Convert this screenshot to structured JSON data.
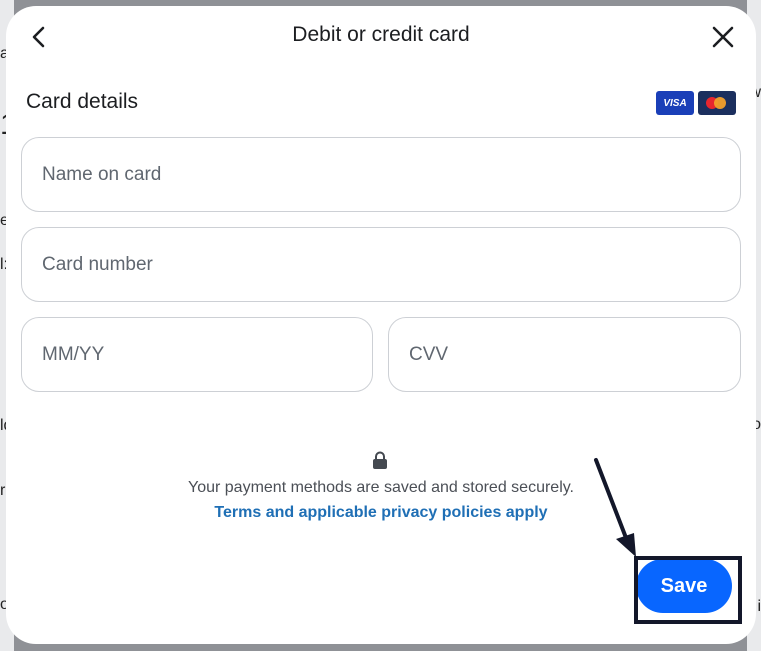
{
  "header": {
    "title": "Debit or credit card",
    "back_icon": "chevron-left-icon",
    "close_icon": "close-icon"
  },
  "card_details": {
    "title": "Card details",
    "logos": {
      "visa": "VISA",
      "mastercard": "mastercard-icon"
    }
  },
  "form": {
    "name_placeholder": "Name on card",
    "number_placeholder": "Card number",
    "expiry_placeholder": "MM/YY",
    "cvv_placeholder": "CVV"
  },
  "footer": {
    "lock_icon": "lock-icon",
    "secure_text": "Your payment methods are saved and stored securely.",
    "terms_link": "Terms and applicable privacy policies apply",
    "save_label": "Save"
  },
  "colors": {
    "primary": "#0866ff",
    "link": "#1f6fb5",
    "annotation": "#13172a"
  },
  "background_fragments": {
    "left": [
      "ar",
      "1",
      "e",
      "l:",
      "ld",
      "r",
      "o"
    ],
    "right": [
      "w",
      "o",
      "i"
    ]
  }
}
